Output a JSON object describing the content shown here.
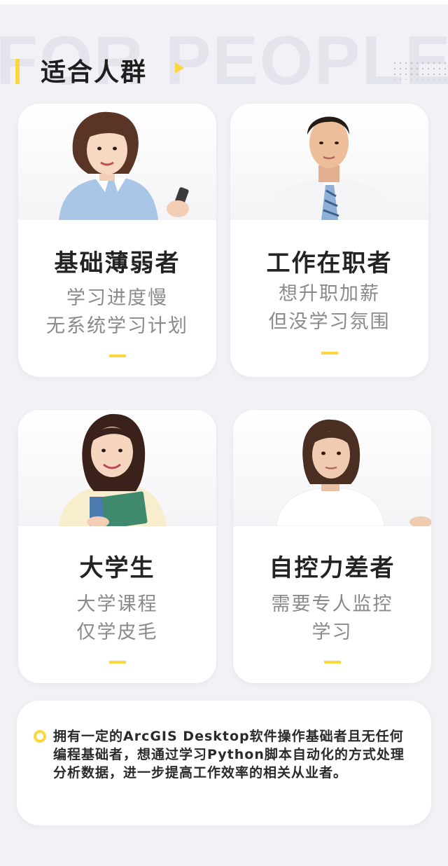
{
  "header": {
    "bg_word": "FOR PEOPLE",
    "title": "适合人群"
  },
  "cards": [
    {
      "title": "基础薄弱者",
      "lines": [
        "学习进度慢",
        "无系统学习计划"
      ]
    },
    {
      "title": "工作在职者",
      "lines": [
        "想升职加薪",
        "但没学习氛围"
      ]
    },
    {
      "title": "大学生",
      "lines": [
        "大学课程",
        "仅学皮毛"
      ]
    },
    {
      "title": "自控力差者",
      "lines": [
        "需要专人监控",
        "学习"
      ]
    }
  ],
  "note": {
    "text": "拥有一定的ArcGIS Desktop软件操作基础者且无任何编程基础者，想通过学习Python脚本自动化的方式处理分析数据，进一步提高工作效率的相关从业者。"
  },
  "colors": {
    "accent": "#fbd63c",
    "background": "#f2f2f6",
    "card": "#ffffff"
  }
}
